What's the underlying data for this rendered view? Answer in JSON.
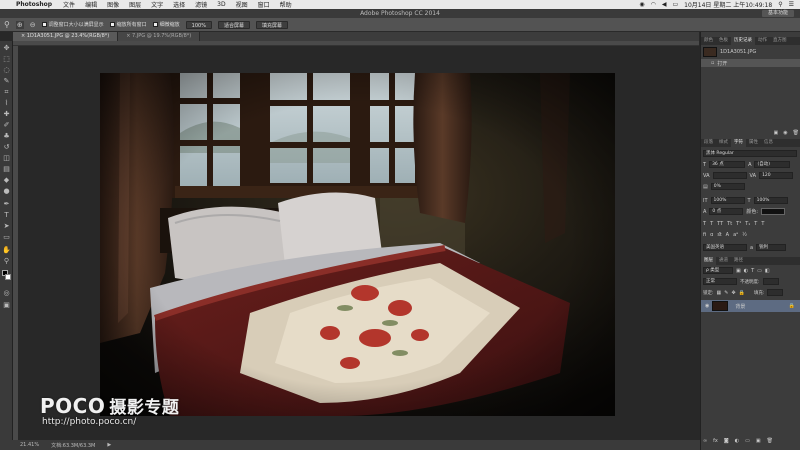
{
  "menubar": {
    "app": "Photoshop",
    "items": [
      "文件",
      "编辑",
      "图像",
      "图层",
      "文字",
      "选择",
      "滤镜",
      "3D",
      "视图",
      "窗口",
      "帮助"
    ],
    "clock": "10月14日 星期二 上午10:49:18"
  },
  "window": {
    "title": "Adobe Photoshop CC 2014",
    "workspace": "基本功能"
  },
  "options": {
    "resize_windows": "调整窗口大小以满屏显示",
    "zoom_all": "缩放所有窗口",
    "scrubby_zoom": "细微缩放",
    "btn_100": "100%",
    "fit_screen": "适合屏幕",
    "fill_screen": "填充屏幕"
  },
  "tabs": [
    {
      "label": "1D1A3051.JPG @ 23.4%(RGB/8*)"
    },
    {
      "label": "7.JPG @ 19.7%(RGB/8*)"
    }
  ],
  "status": {
    "zoom": "21.41%",
    "doc": "文档:63.3M/63.3M"
  },
  "history": {
    "tabs": [
      "颜色",
      "色板",
      "历史记录",
      "动作",
      "直方图"
    ],
    "snapshot": "1D1A3051.JPG",
    "step": "打开"
  },
  "character": {
    "tabs": [
      "段落",
      "样式",
      "字符",
      "属性",
      "信息"
    ],
    "font": "黑体 Regular",
    "size": "36 点",
    "leading": "(自动)",
    "kerning": "",
    "tracking": "120",
    "scale_tracking": "0%",
    "vscale": "100%",
    "hscale": "100%",
    "baseline": "0 点",
    "color_label": "颜色:",
    "style_buttons": [
      "T",
      "T",
      "TT",
      "Tt",
      "T¹",
      "T₁",
      "T",
      "T"
    ],
    "lang": "美国英语",
    "aa": "锐利"
  },
  "layers": {
    "tabs": [
      "图层",
      "通道",
      "路径"
    ],
    "filter": "ρ 类型",
    "blend": "正常",
    "opacity_label": "不透明度:",
    "lock_label": "锁定:",
    "fill_label": "填充:",
    "layer_name": "背景"
  },
  "watermark": {
    "brand": "POCO",
    "cn": "摄影专题",
    "url": "http://photo.poco.cn/"
  },
  "colors": {
    "accent": "#5d6b82"
  }
}
